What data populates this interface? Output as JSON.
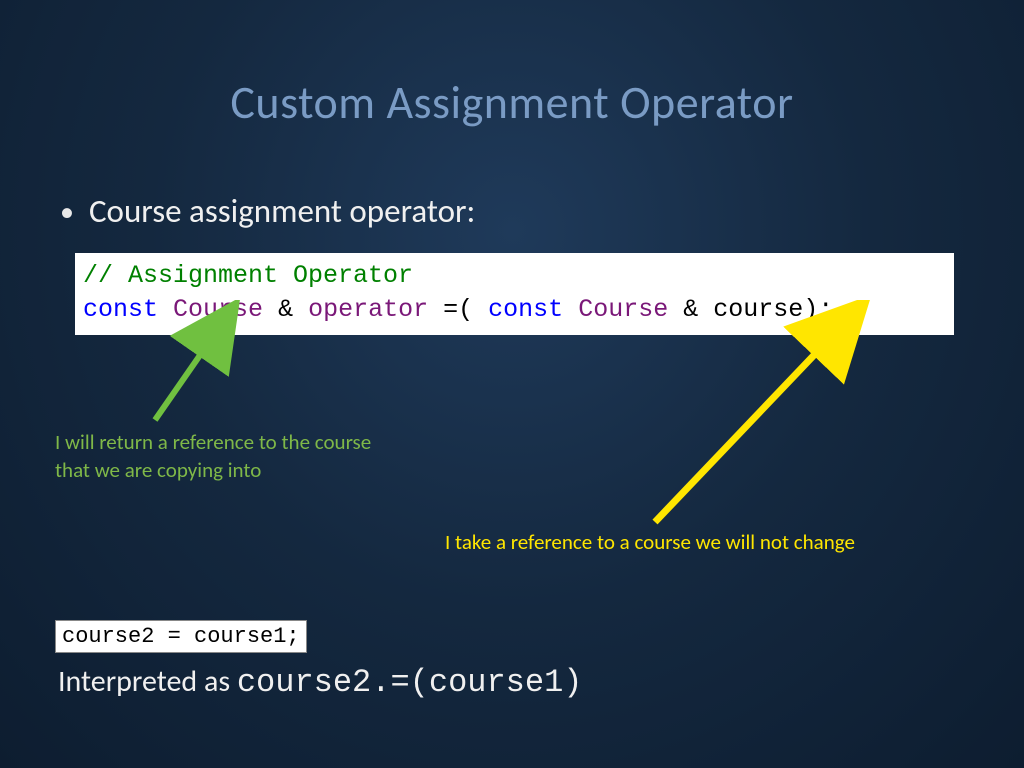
{
  "title": "Custom Assignment Operator",
  "bullet": {
    "marker": "•",
    "text": "Course assignment operator:"
  },
  "code_main": {
    "comment": "// Assignment Operator",
    "line2": {
      "const1": "const",
      "type1": "Course",
      "amp1": "&",
      "func": "operator",
      "eq": "=(",
      "const2": "const",
      "type2": "Course",
      "amp2": "&",
      "param": "course);"
    }
  },
  "annotations": {
    "green": "I will return a reference to the course\nthat we are copying into",
    "yellow": "I take a reference to a course we will not change"
  },
  "code_small": "course2 = course1;",
  "interpreted": {
    "prefix": "Interpreted as ",
    "code": "course2.=(course1)"
  },
  "colors": {
    "green_arrow": "#70c040",
    "yellow_arrow": "#ffe600"
  }
}
